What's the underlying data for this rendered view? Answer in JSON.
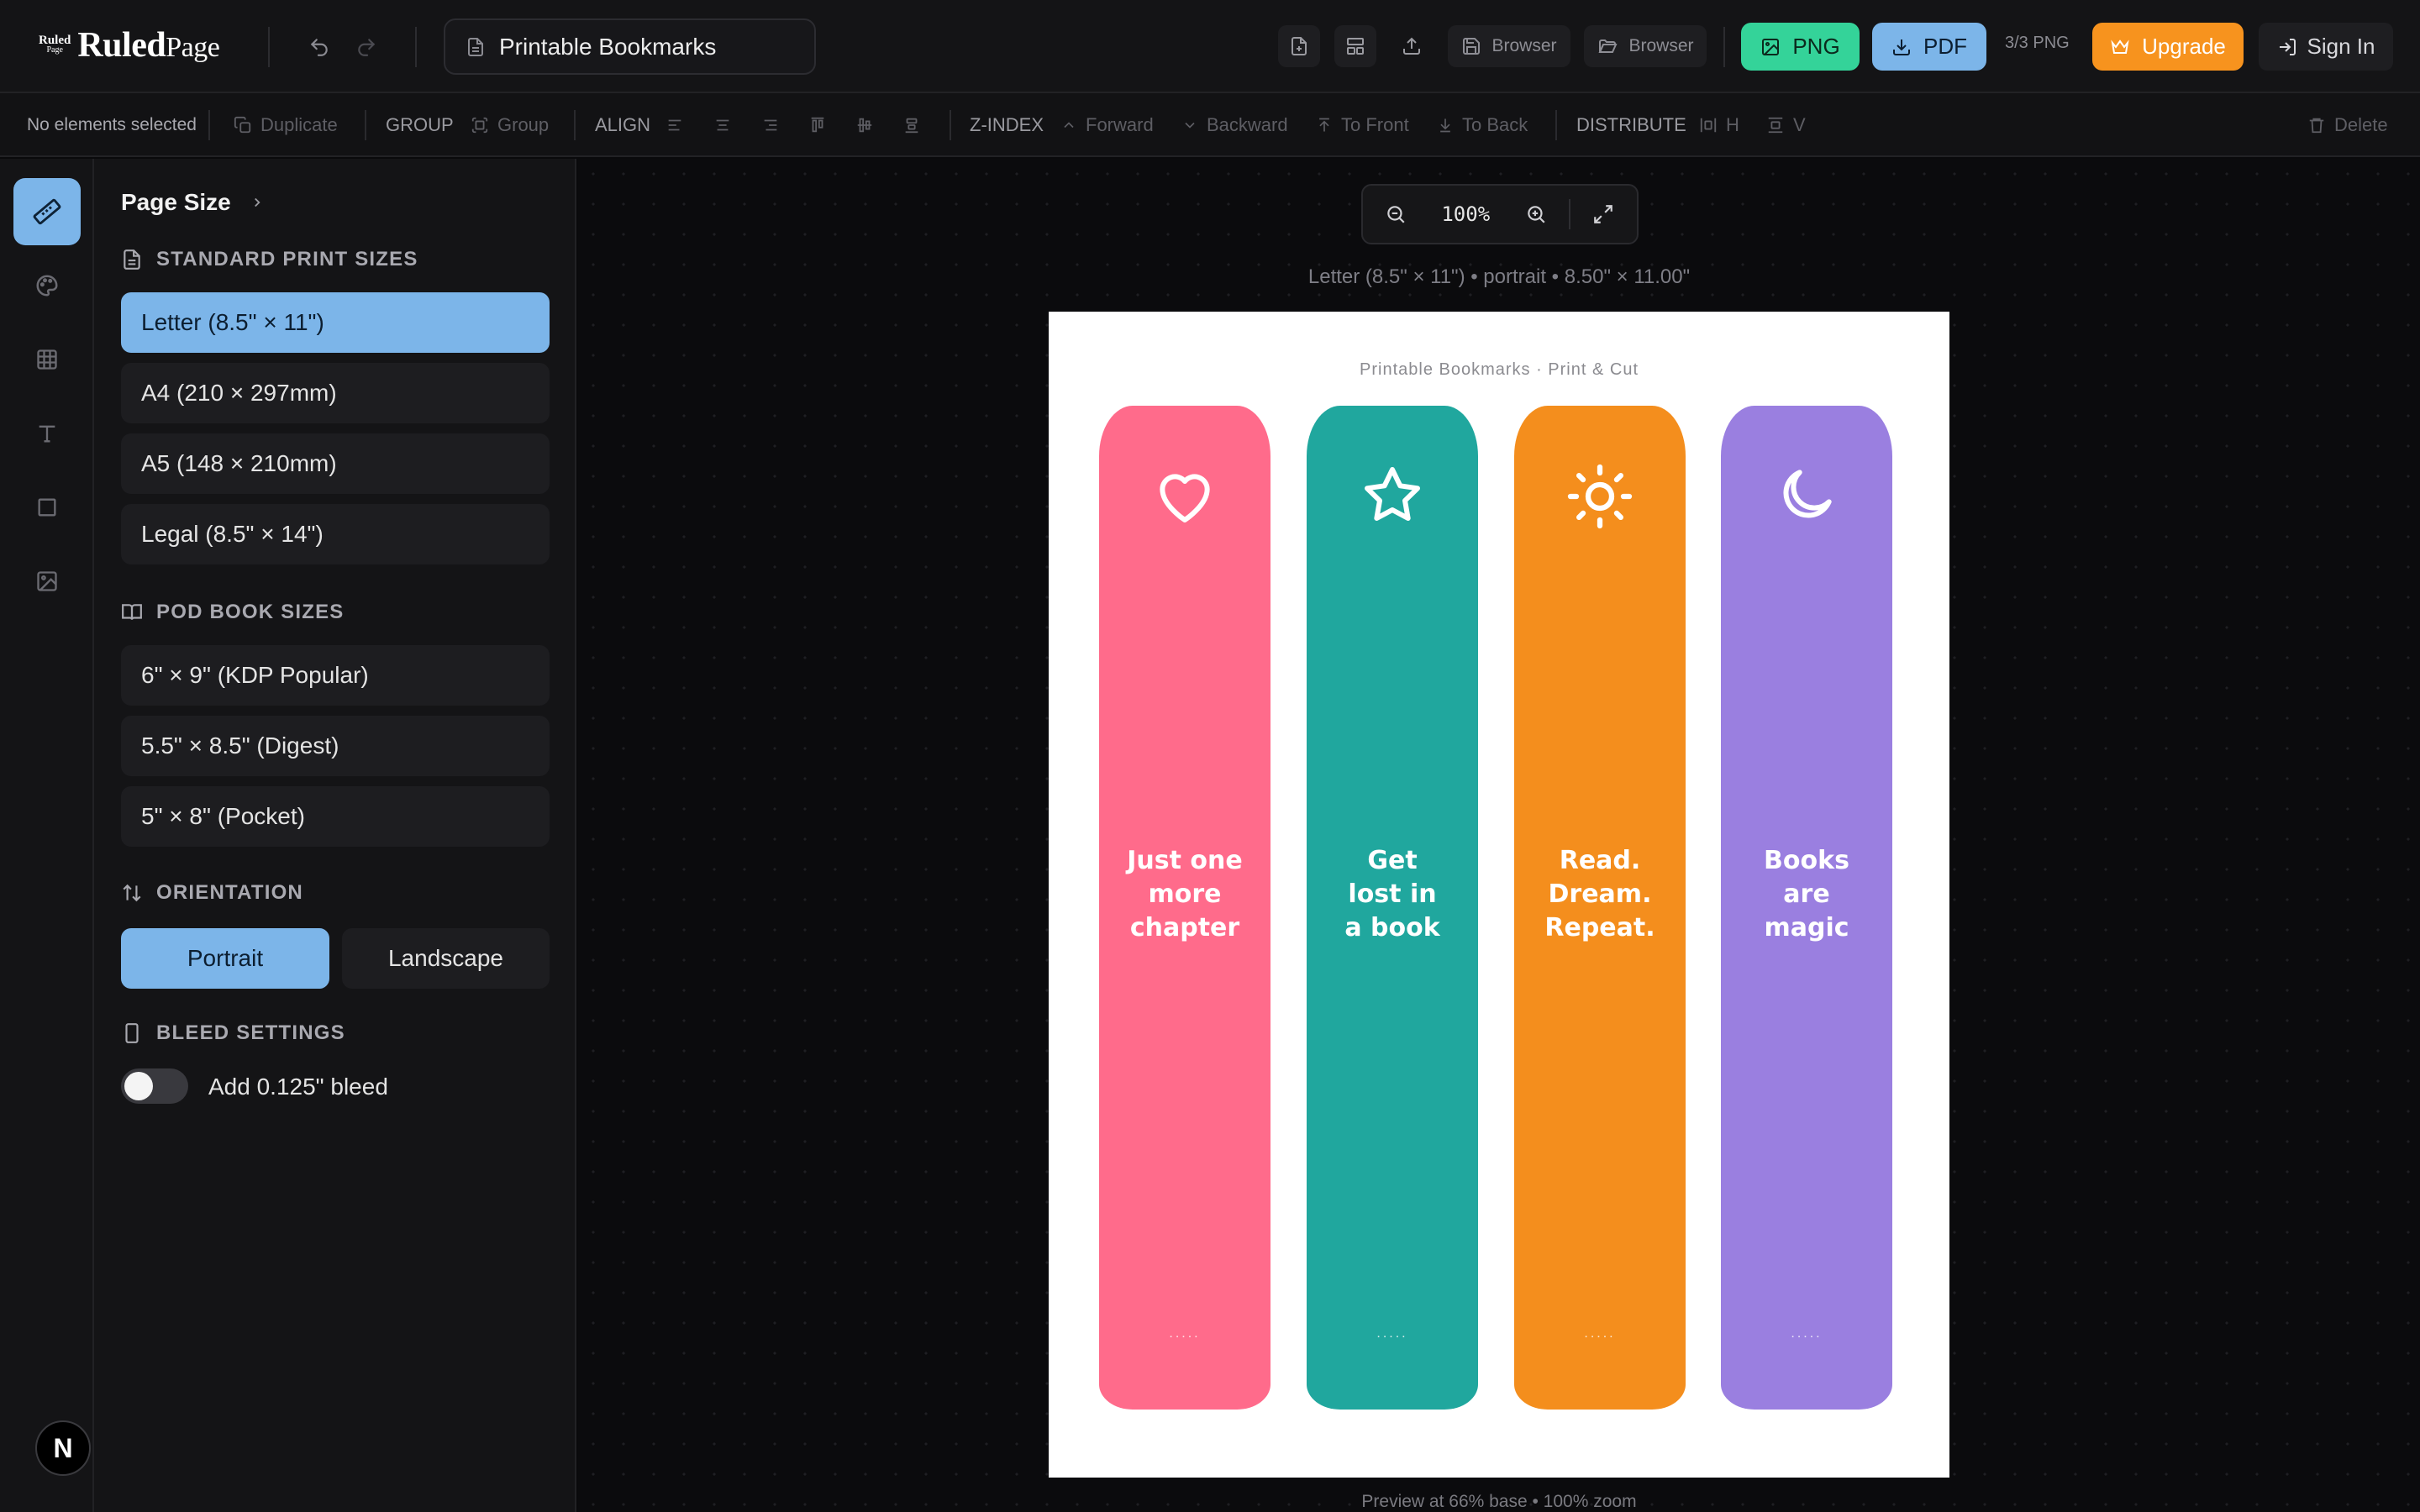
{
  "topbar": {
    "logo_mark_top": "Ruled",
    "logo_mark_bottom": "Page",
    "logo_main": "Ruled",
    "logo_sub": "Page",
    "doc_title": "Printable Bookmarks",
    "save_browser_label": "Browser",
    "open_browser_label": "Browser",
    "png_label": "PNG",
    "pdf_label": "PDF",
    "png_quota": "3/3 PNG",
    "upgrade_label": "Upgrade",
    "signin_label": "Sign In"
  },
  "toolbar": {
    "selection_status": "No elements selected",
    "duplicate": "Duplicate",
    "group_heading": "GROUP",
    "group": "Group",
    "align_heading": "ALIGN",
    "zindex_heading": "Z-INDEX",
    "forward": "Forward",
    "backward": "Backward",
    "to_front": "To Front",
    "to_back": "To Back",
    "distribute_heading": "DISTRIBUTE",
    "distribute_h": "H",
    "distribute_v": "V",
    "delete": "Delete"
  },
  "panel": {
    "title": "Page Size",
    "standard_heading": "STANDARD PRINT SIZES",
    "standard_sizes": [
      "Letter (8.5\" × 11\")",
      "A4 (210 × 297mm)",
      "A5 (148 × 210mm)",
      "Legal (8.5\" × 14\")"
    ],
    "pod_heading": "POD BOOK SIZES",
    "pod_sizes": [
      "6\" × 9\" (KDP Popular)",
      "5.5\" × 8.5\" (Digest)",
      "5\" × 8\" (Pocket)"
    ],
    "orientation_heading": "ORIENTATION",
    "portrait": "Portrait",
    "landscape": "Landscape",
    "bleed_heading": "BLEED SETTINGS",
    "bleed_label": "Add 0.125\" bleed",
    "bleed_enabled": false
  },
  "canvas": {
    "zoom": "100%",
    "page_info": "Letter (8.5\" × 11\") • portrait • 8.50\" × 11.00\"",
    "page_header": "Printable Bookmarks · Print & Cut",
    "footer_note": "Preview at 66% base • 100% zoom",
    "bookmarks": [
      {
        "text": "Just one\nmore\nchapter",
        "icon": "heart-icon",
        "color": "#ff6b8b",
        "dots": "....."
      },
      {
        "text": "Get\nlost in\na book",
        "icon": "star-icon",
        "color": "#20a79e",
        "dots": "....."
      },
      {
        "text": "Read.\nDream.\nRepeat.",
        "icon": "sun-icon",
        "color": "#f48e1d",
        "dots": "....."
      },
      {
        "text": "Books\nare\nmagic",
        "icon": "moon-icon",
        "color": "#9a7fe0",
        "dots": "....."
      }
    ]
  },
  "avatar_letter": "N",
  "colors": {
    "png_button": "#34d399",
    "pdf_button": "#7cb5e9",
    "upgrade_button": "#f7931e",
    "selected": "#7cb5e9"
  }
}
